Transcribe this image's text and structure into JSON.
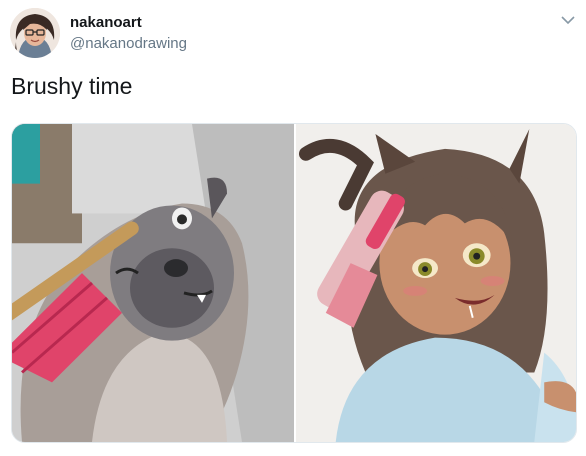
{
  "author": {
    "display_name": "nakanoart",
    "handle": "@nakanodrawing",
    "avatar_icon": "avatar-drawing-icon"
  },
  "tweet": {
    "text": "Brushy time"
  },
  "menu": {
    "icon": "chevron-down-icon",
    "color": "#8899a6"
  },
  "media": {
    "left_image": "cat-being-brushed-photo",
    "right_image": "anime-girl-being-brushed-drawing"
  },
  "colors": {
    "name": "#14171a",
    "handle": "#657786",
    "brush_pink": "#e0446a"
  }
}
